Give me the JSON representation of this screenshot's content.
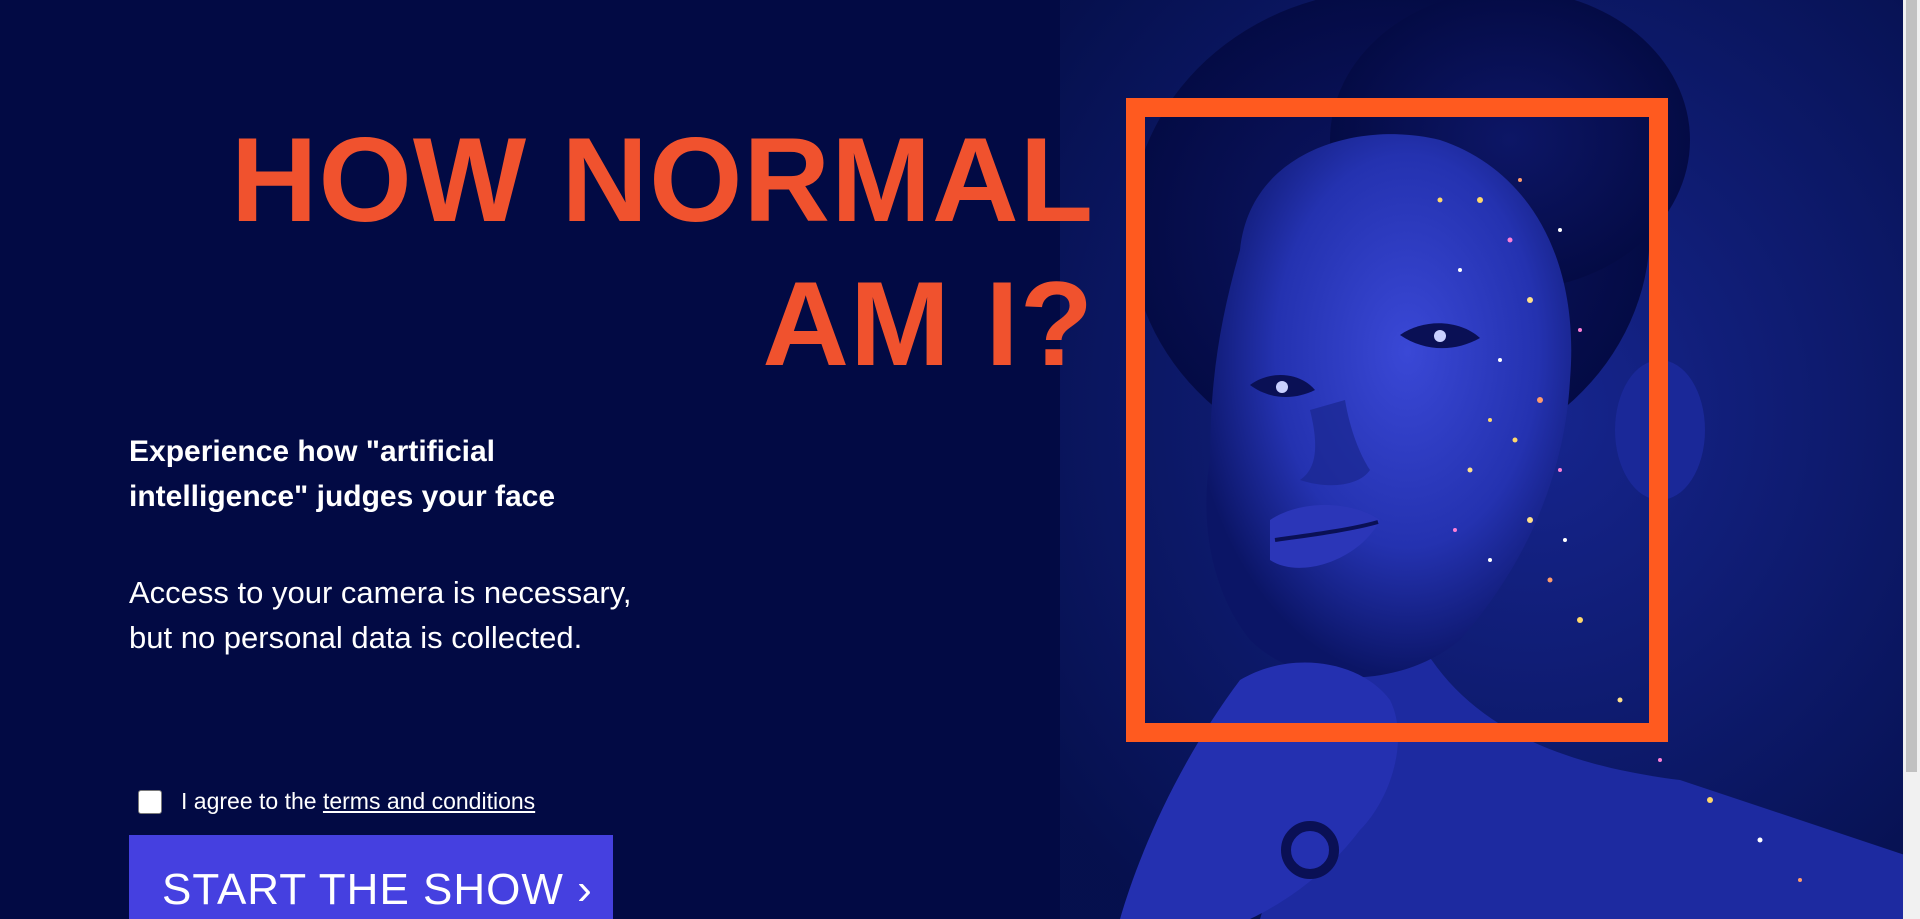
{
  "hero": {
    "title_line1": "HOW NORMAL",
    "title_line2": "AM I?",
    "lead_line1": "Experience how \"artificial",
    "lead_line2": "intelligence\" judges your face",
    "note_line1": "Access to your camera is necessary,",
    "note_line2": "but no personal data is collected."
  },
  "consent": {
    "checked": false,
    "prefix": "I agree to the ",
    "link_label": "terms and conditions"
  },
  "cta": {
    "label": "START THE SHOW ›"
  },
  "colors": {
    "background": "#020a44",
    "accent": "#f0522e",
    "frame": "#ff5a1f",
    "button": "#4540e0"
  }
}
